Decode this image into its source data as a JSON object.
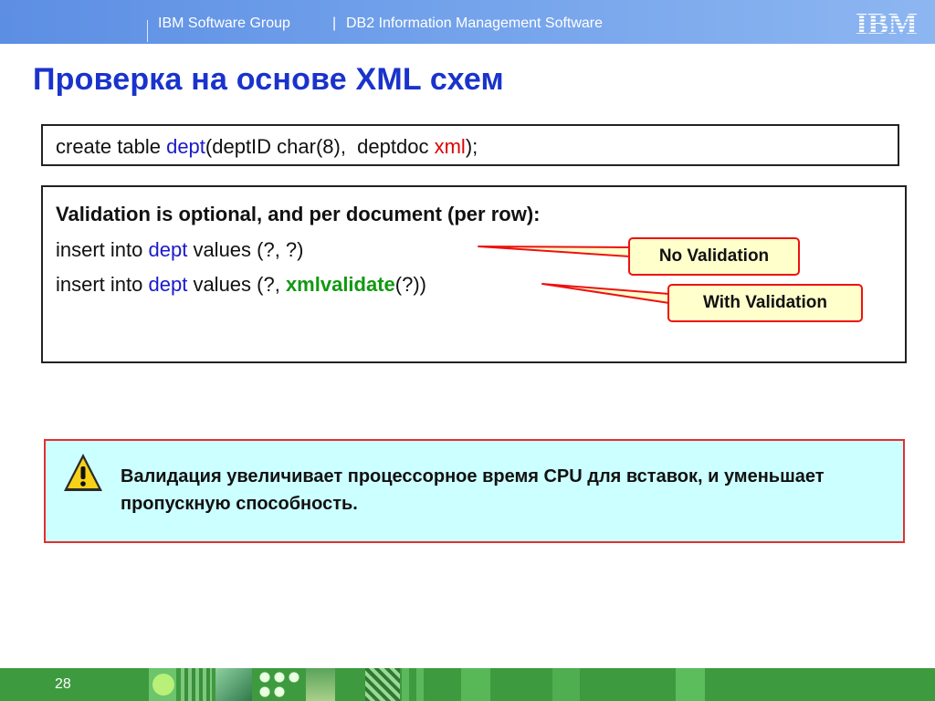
{
  "header": {
    "group": "IBM Software Group",
    "separator": "|",
    "product": "DB2 Information Management Software",
    "logo_text": "IBM"
  },
  "title": "Проверка на основе XML схем",
  "code_box_1": {
    "t1": "create table ",
    "t2": "dept",
    "t3": "(deptID char(8),  deptdoc ",
    "t4": "xml",
    "t5": ");"
  },
  "code_box_2": {
    "heading": "Validation is optional, and per document (per row):",
    "line1": {
      "t1": "insert into ",
      "t2": "dept",
      "t3": " values (?, ?)"
    },
    "line2": {
      "t1": "insert into ",
      "t2": "dept",
      "t3": " values (?, ",
      "t4": "xmlvalidate",
      "t5": "(?))"
    }
  },
  "callouts": {
    "no_validation": "No Validation",
    "with_validation": "With Validation"
  },
  "warning": {
    "icon": "warning-icon",
    "text": "Валидация увеличивает процессорное время CPU для вставок, и уменьшает пропускную способность."
  },
  "footer": {
    "page_number": "28"
  },
  "colors": {
    "header_blue": "#6f9fea",
    "title_blue": "#1a33cc",
    "keyword_blue": "#1a1acc",
    "keyword_red": "#e00000",
    "keyword_green": "#119911",
    "callout_bg": "#ffffcc",
    "warning_bg": "#ccffff",
    "footer_green": "#3e9a3e"
  }
}
